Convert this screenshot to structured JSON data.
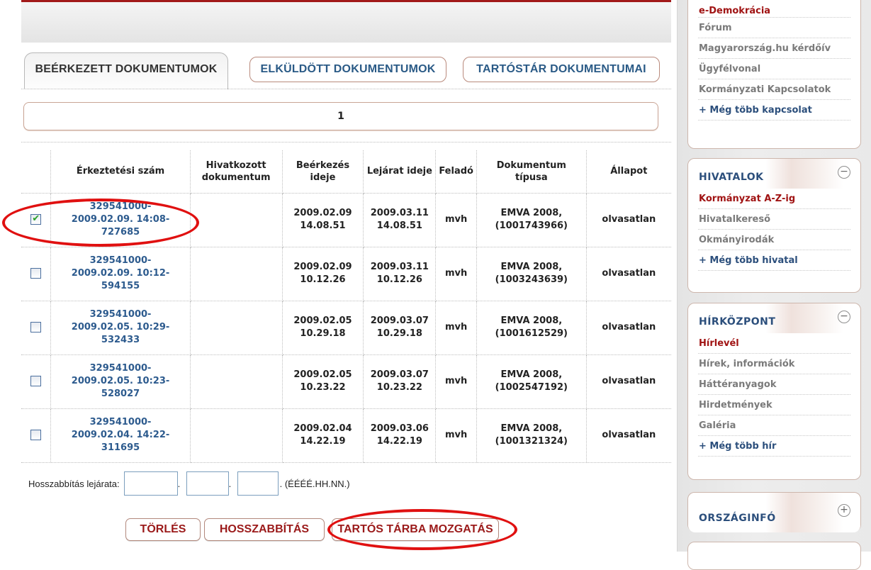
{
  "tabs": {
    "inbox": "BEÉRKEZETT DOKUMENTUMOK",
    "sent": "ELKÜLDÖTT DOKUMENTUMOK",
    "archive": "TARTÓSTÁR DOKUMENTUMAI"
  },
  "pager": {
    "current_page": "1"
  },
  "table": {
    "headers": [
      "Érkeztetési szám",
      "Hivatkozott dokumentum",
      "Beérkezés ideje",
      "Lejárat ideje",
      "Feladó",
      "Dokumentum típusa",
      "Állapot"
    ],
    "rows": [
      {
        "checked": true,
        "num_a": "329541000-",
        "num_b": "2009.02.09. 14:08-",
        "num_c": "727685",
        "ref": "",
        "recv_date": "2009.02.09",
        "recv_time": "14.08.51",
        "exp_date": "2009.03.11",
        "exp_time": "14.08.51",
        "sender": "mvh",
        "type_a": "EMVA 2008,",
        "type_b": "(1001743966)",
        "status": "olvasatlan"
      },
      {
        "checked": false,
        "num_a": "329541000-",
        "num_b": "2009.02.09. 10:12-",
        "num_c": "594155",
        "ref": "",
        "recv_date": "2009.02.09",
        "recv_time": "10.12.26",
        "exp_date": "2009.03.11",
        "exp_time": "10.12.26",
        "sender": "mvh",
        "type_a": "EMVA 2008,",
        "type_b": "(1003243639)",
        "status": "olvasatlan"
      },
      {
        "checked": false,
        "num_a": "329541000-",
        "num_b": "2009.02.05. 10:29-",
        "num_c": "532433",
        "ref": "",
        "recv_date": "2009.02.05",
        "recv_time": "10.29.18",
        "exp_date": "2009.03.07",
        "exp_time": "10.29.18",
        "sender": "mvh",
        "type_a": "EMVA 2008,",
        "type_b": "(1001612529)",
        "status": "olvasatlan"
      },
      {
        "checked": false,
        "num_a": "329541000-",
        "num_b": "2009.02.05. 10:23-",
        "num_c": "528027",
        "ref": "",
        "recv_date": "2009.02.05",
        "recv_time": "10.23.22",
        "exp_date": "2009.03.07",
        "exp_time": "10.23.22",
        "sender": "mvh",
        "type_a": "EMVA 2008,",
        "type_b": "(1002547192)",
        "status": "olvasatlan"
      },
      {
        "checked": false,
        "num_a": "329541000-",
        "num_b": "2009.02.04. 14:22-",
        "num_c": "311695",
        "ref": "",
        "recv_date": "2009.02.04",
        "recv_time": "14.22.19",
        "exp_date": "2009.03.06",
        "exp_time": "14.22.19",
        "sender": "mvh",
        "type_a": "EMVA 2008,",
        "type_b": "(1001321324)",
        "status": "olvasatlan"
      }
    ]
  },
  "extension": {
    "label": "Hosszabbítás lejárata:",
    "year_value": "",
    "month_value": "",
    "day_value": "",
    "dot": ".",
    "format_hint": ". (ÉÉÉÉ.HH.NN.)"
  },
  "actions": {
    "delete": "TÖRLÉS",
    "extend": "HOSSZABBÍTÁS",
    "move": "TARTÓS TÁRBA MOZGATÁS"
  },
  "sidebar": {
    "links_top": {
      "items": [
        "e-Demokrácia",
        "Fórum",
        "Magyarország.hu kérdőív",
        "Ügyfélvonal",
        "Kormányzati Kapcsolatok",
        "+ Még több kapcsolat"
      ]
    },
    "hivatalok": {
      "title": "HIVATALOK",
      "toggle": "−",
      "items": [
        "Kormányzat A-Z-ig",
        "Hivatalkereső",
        "Okmányirodák",
        "+ Még több hivatal"
      ]
    },
    "hirkozpont": {
      "title": "HÍRKÖZPONT",
      "toggle": "−",
      "items": [
        "Hírlevél",
        "Hírek, információk",
        "Háttéranyagok",
        "Hirdetmények",
        "Galéria",
        "+ Még több hír"
      ]
    },
    "orszaginfo": {
      "title": "ORSZÁGINFÓ",
      "toggle": "+"
    }
  },
  "colors": {
    "accent_red": "#a01313",
    "link_blue": "#2d5b8e",
    "annotation_red": "#e01010"
  }
}
